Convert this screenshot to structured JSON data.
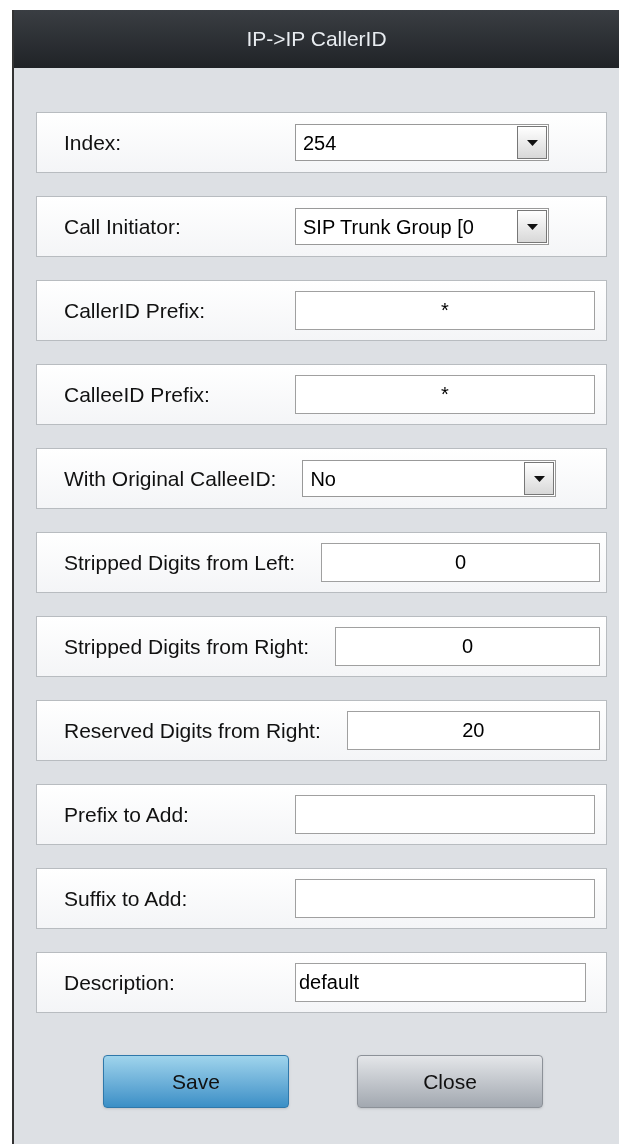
{
  "window": {
    "title": "IP->IP CallerID"
  },
  "fields": [
    {
      "label": "Index:",
      "kind": "select",
      "value": "254"
    },
    {
      "label": "Call Initiator:",
      "kind": "select",
      "value": "SIP Trunk Group [0"
    },
    {
      "label": "CallerID Prefix:",
      "kind": "text",
      "value": "*"
    },
    {
      "label": "CalleeID Prefix:",
      "kind": "text",
      "value": "*"
    },
    {
      "label": "With Original CalleeID:",
      "kind": "select",
      "value": "No"
    },
    {
      "label": "Stripped Digits from Left:",
      "kind": "text",
      "value": "0"
    },
    {
      "label": "Stripped Digits from Right:",
      "kind": "text",
      "value": "0"
    },
    {
      "label": "Reserved Digits from Right:",
      "kind": "text",
      "value": "20"
    },
    {
      "label": "Prefix to Add:",
      "kind": "text"
    },
    {
      "label": "Suffix to Add:",
      "kind": "text"
    },
    {
      "label": "Description:",
      "kind": "description",
      "value": "default"
    }
  ],
  "buttons": [
    {
      "label": "Save",
      "kind": "primary"
    },
    {
      "label": "Close",
      "kind": "secondary"
    }
  ]
}
